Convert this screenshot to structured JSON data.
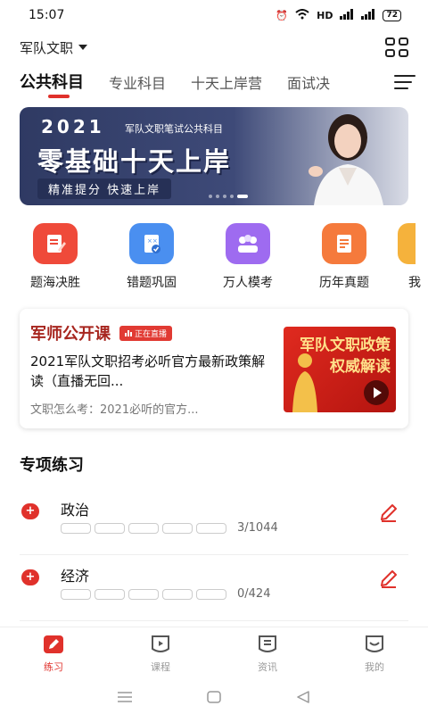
{
  "status": {
    "time": "15:07",
    "battery": "72",
    "network": "HD"
  },
  "header": {
    "exam_name": "军队文职"
  },
  "tabs": [
    "公共科目",
    "专业科目",
    "十天上岸营",
    "面试决"
  ],
  "banner": {
    "year": "2021",
    "subtitle": "军队文职笔试公共科目",
    "title": "零基础十天上岸",
    "pill": "精准提分  快速上岸"
  },
  "quick_actions": [
    {
      "label": "题海决胜",
      "icon": "edit-icon",
      "color": "#ef4a3a"
    },
    {
      "label": "错题巩固",
      "icon": "wrong-questions-icon",
      "color": "#4a8ff0"
    },
    {
      "label": "万人模考",
      "icon": "mock-exam-icon",
      "color": "#9e6bf0"
    },
    {
      "label": "历年真题",
      "icon": "past-papers-icon",
      "color": "#f57a3c"
    },
    {
      "label": "我",
      "icon": "more-icon",
      "color": "#f5b23c"
    }
  ],
  "live": {
    "title": "军师公开课",
    "badge": "正在直播",
    "description": "2021军队文职招考必听官方最新政策解读（直播无回...",
    "meta": "文职怎么考：2021必听的官方...",
    "thumb_line1": "军队文职政策",
    "thumb_line2": "权威解读"
  },
  "section": {
    "title": "专项练习"
  },
  "practice": [
    {
      "name": "政治",
      "count": "3/1044"
    },
    {
      "name": "经济",
      "count": "0/424"
    }
  ],
  "bottom_nav": [
    {
      "label": "练习",
      "active": true
    },
    {
      "label": "课程",
      "active": false
    },
    {
      "label": "资讯",
      "active": false
    },
    {
      "label": "我的",
      "active": false
    }
  ],
  "colors": {
    "accent": "#e0312b",
    "banner": "#2f3a63"
  }
}
